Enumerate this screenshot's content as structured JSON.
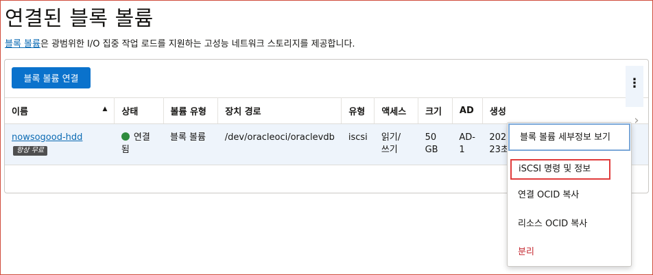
{
  "page": {
    "title": "연결된 블록 볼륨",
    "description_link": "블록 볼륨",
    "description_rest": "은 광범위한 I/O 집중 작업 로드를 지원하는 고성능 네트워크 스토리지를 제공합니다."
  },
  "toolbar": {
    "attach_label": "블록 볼륨 연결"
  },
  "table": {
    "columns": [
      "이름",
      "상태",
      "볼륨 유형",
      "장치 경로",
      "유형",
      "액세스",
      "크기",
      "AD",
      "생성"
    ],
    "sort_indicator": "▲",
    "rows": [
      {
        "name": "nowsogood-hdd",
        "badge": "항상 무료",
        "state_line1": "연결",
        "state_line2": "됨",
        "volume_type": "블록 볼륨",
        "device_path": "/dev/oracleoci/oraclevdb",
        "type": "iscsi",
        "access_line1": "읽기/",
        "access_line2": "쓰기",
        "size_line1": "50",
        "size_line2": "GB",
        "ad_line1": "AD-",
        "ad_line2": "1",
        "created_line1": "2021",
        "created_line2": "23초"
      }
    ]
  },
  "menu": {
    "items": [
      {
        "label": "블록 볼륨 세부정보 보기"
      },
      {
        "label": "iSCSI 명령 및 정보"
      },
      {
        "label": "연결 OCID 복사"
      },
      {
        "label": "리소스 OCID 복사"
      },
      {
        "label": "분리"
      }
    ]
  },
  "icons": {
    "kebab": "kebab-icon",
    "state": "status-dot-icon",
    "scroll": "chevron-right-icon"
  },
  "colors": {
    "accent": "#0a72cc",
    "link": "#0a6ab3",
    "danger": "#c4262e",
    "state_ok": "#2e8b3d",
    "highlight": "#e03a3a"
  }
}
